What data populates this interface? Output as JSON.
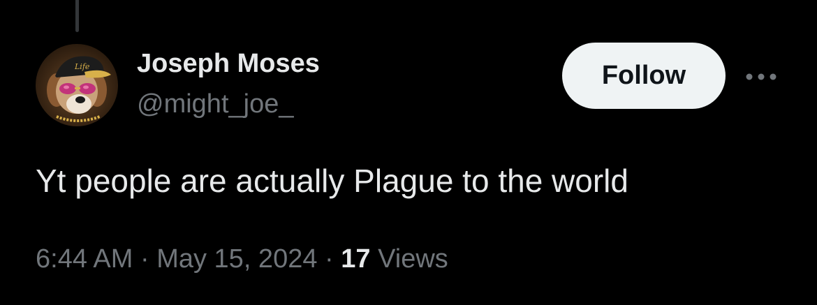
{
  "author": {
    "display_name": "Joseph Moses",
    "handle": "@might_joe_",
    "avatar_icon": "dog-with-cap-and-sunglasses-avatar",
    "avatar_cap_text": "Life"
  },
  "actions": {
    "follow_label": "Follow",
    "more_icon": "more-horizontal-icon"
  },
  "tweet": {
    "text": "Yt people are actually Plague to the world"
  },
  "meta": {
    "time": "6:44 AM",
    "separator": " · ",
    "date": "May 15, 2024",
    "views_count": "17",
    "views_label": " Views"
  },
  "colors": {
    "background": "#000000",
    "primary_text": "#e7e9ea",
    "secondary_text": "#71767b",
    "follow_button_bg": "#eff3f4",
    "follow_button_text": "#0f1419",
    "thread_line": "#333639"
  }
}
